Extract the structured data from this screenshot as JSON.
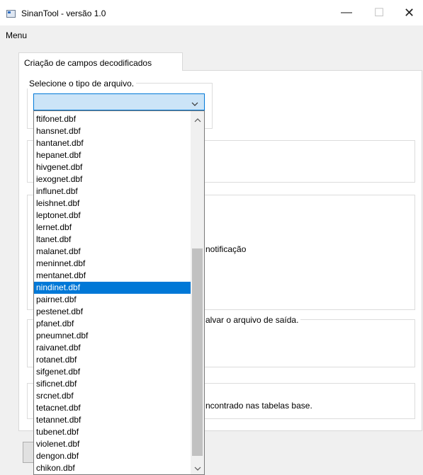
{
  "window": {
    "title": "SinanTool - versão 1.0",
    "minimize_glyph": "—",
    "maximize_glyph": "☐",
    "close_glyph": "✕"
  },
  "menu": {
    "items": [
      "Menu"
    ]
  },
  "tab": {
    "label": "Criação de campos decodificados"
  },
  "group1": {
    "legend": "Selecione o tipo de arquivo."
  },
  "combo": {
    "value": "",
    "chevron": "⌵"
  },
  "labels": {
    "notificacao": "notificação",
    "salvar": "alvar o arquivo de saída.",
    "encontrado": "ncontrado nas tabelas base."
  },
  "dropdown": {
    "items": [
      "ftifonet.dbf",
      "hansnet.dbf",
      "hantanet.dbf",
      "hepanet.dbf",
      "hivgenet.dbf",
      "iexognet.dbf",
      "influnet.dbf",
      "leishnet.dbf",
      "leptonet.dbf",
      "lernet.dbf",
      "ltanet.dbf",
      "malanet.dbf",
      "meninnet.dbf",
      "mentanet.dbf",
      "nindinet.dbf",
      "pairnet.dbf",
      "pestenet.dbf",
      "pfanet.dbf",
      "pneumnet.dbf",
      "raivanet.dbf",
      "rotanet.dbf",
      "sifgenet.dbf",
      "sificnet.dbf",
      "srcnet.dbf",
      "tetacnet.dbf",
      "tetannet.dbf",
      "tubenet.dbf",
      "violenet.dbf",
      "dengon.dbf",
      "chikon.dbf"
    ],
    "selected": "nindinet.dbf",
    "scroll_up_glyph": "⌃",
    "scroll_down_glyph": "⌄"
  }
}
